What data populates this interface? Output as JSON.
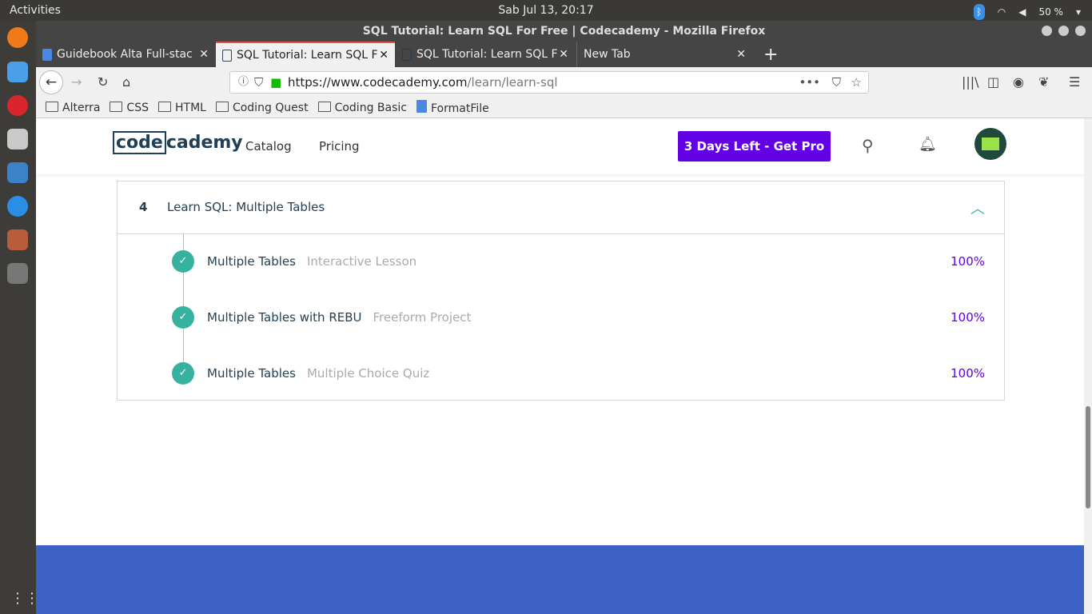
{
  "system": {
    "activities": "Activities",
    "clock": "Sab Jul 13, 20:17",
    "battery": "50 %"
  },
  "window": {
    "title": "SQL Tutorial: Learn SQL For Free | Codecademy - Mozilla Firefox"
  },
  "tabs": [
    {
      "label": "Guidebook Alta Full-stac"
    },
    {
      "label": "SQL Tutorial: Learn SQL F"
    },
    {
      "label": "SQL Tutorial: Learn SQL F"
    },
    {
      "label": "New Tab"
    }
  ],
  "url": {
    "host": "https://www.codecademy.com",
    "path": "/learn/learn-sql"
  },
  "bookmarks": [
    "Alterra",
    "CSS",
    "HTML",
    "Coding Quest",
    "Coding Basic",
    "FormatFile"
  ],
  "header": {
    "logo": "codecademy",
    "logo_box": "code",
    "logo_rest": "cademy",
    "catalog": "Catalog",
    "pricing": "Pricing",
    "pro_button": "3 Days Left - Get Pro"
  },
  "section": {
    "number": "4",
    "title": "Learn SQL: Multiple Tables",
    "items": [
      {
        "name": "Multiple Tables",
        "type": "Interactive Lesson",
        "progress": "100%"
      },
      {
        "name": "Multiple Tables with REBU",
        "type": "Freeform Project",
        "progress": "100%"
      },
      {
        "name": "Multiple Tables",
        "type": "Multiple Choice Quiz",
        "progress": "100%"
      }
    ]
  },
  "colors": {
    "accent": "#6400e4",
    "check": "#36b3a0",
    "footer": "#3b62c4"
  }
}
